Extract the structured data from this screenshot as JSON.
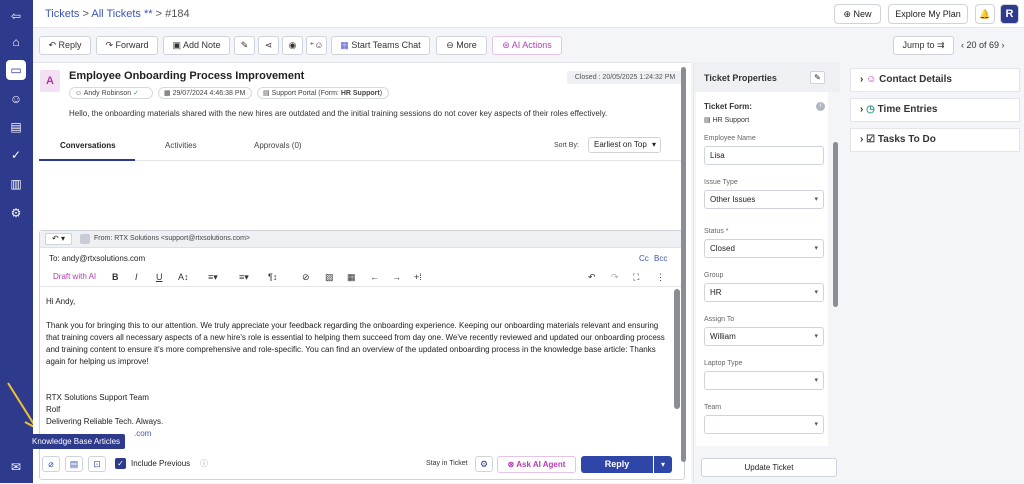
{
  "nav": {
    "icons": [
      "logout-icon",
      "home-icon",
      "tickets-icon",
      "contacts-icon",
      "knowledge-base-icon",
      "approvals-icon",
      "reports-icon",
      "settings-icon",
      "chat-icon"
    ]
  },
  "breadcrumb": {
    "tickets": "Tickets",
    "sep1": ">",
    "all": "All Tickets **",
    "sep2": ">",
    "id": "#184"
  },
  "topbar": {
    "new": "New",
    "explore": "Explore My Plan",
    "user_initial": "R"
  },
  "toolbar": {
    "reply": "Reply",
    "forward": "Forward",
    "add_note": "Add Note",
    "teams": "Start Teams Chat",
    "more": "More",
    "ai": "AI Actions",
    "jump": "Jump to",
    "pager": "20 of 69"
  },
  "ticket": {
    "avatar": "A",
    "title": "Employee Onboarding Process Improvement",
    "closed": "Closed : 20/05/2025 1:24:32 PM",
    "requester": "Andy Robinson",
    "date": "29/07/2024 4:46:38 PM",
    "source_prefix": "Support Portal (Form: ",
    "source_form": "HR Support",
    "source_suffix": ")",
    "description": "Hello, the onboarding materials shared with the new hires are outdated and the initial training sessions do not cover key aspects of their roles effectively."
  },
  "tabs": [
    {
      "label": "Conversations"
    },
    {
      "label": "Activities"
    },
    {
      "label": "Approvals (0)"
    }
  ],
  "sort": {
    "label": "Sort By:",
    "value": "Earliest on Top"
  },
  "editor": {
    "from": "From:  RTX Solutions <support@rtxsolutions.com>",
    "to": "To: andy@rtxsolutions.com",
    "cc": "Cc",
    "bcc": "Bcc",
    "draft_ai": "Draft with AI",
    "greeting": "Hi Andy,",
    "paragraph": "Thank you for bringing this to our attention. We truly appreciate your feedback regarding the onboarding experience. Keeping our onboarding materials relevant and ensuring that training covers all necessary aspects of a new hire's role is essential to helping them succeed from day one. We've recently reviewed and updated our onboarding process and training content to ensure it's more comprehensive and role-specific. You can find an overview of the updated onboarding process in the knowledge base article: Thanks again for helping us improve!",
    "sig1": "RTX Solutions Support Team",
    "sig2": "Rolf",
    "sig3": "Delivering Reliable Tech. Always.",
    "sig4": ".com"
  },
  "footer": {
    "include_previous": "Include Previous",
    "stay": "Stay in Ticket",
    "ask_ai": "Ask AI Agent",
    "reply": "Reply"
  },
  "tooltip": "Knowledge Base Articles",
  "properties": {
    "title": "Ticket Properties",
    "form_label": "Ticket Form:",
    "form_value": "HR Support",
    "fields": [
      {
        "label": "Employee Name",
        "value": "Lisa"
      },
      {
        "label": "Issue Type",
        "value": "Other Issues"
      },
      {
        "label": "Status *",
        "value": "Closed"
      },
      {
        "label": "Group",
        "value": "HR"
      },
      {
        "label": "Assign To",
        "value": "William"
      },
      {
        "label": "Laptop Type",
        "value": ""
      },
      {
        "label": "Team",
        "value": ""
      }
    ],
    "update": "Update Ticket"
  },
  "right": {
    "contact": "Contact Details",
    "time": "Time Entries",
    "tasks": "Tasks To Do"
  },
  "colors": {
    "nav": "#2e3a8c",
    "accent": "#3a55b4",
    "ai": "#b23cb2",
    "reply_btn": "#2f45a8"
  }
}
